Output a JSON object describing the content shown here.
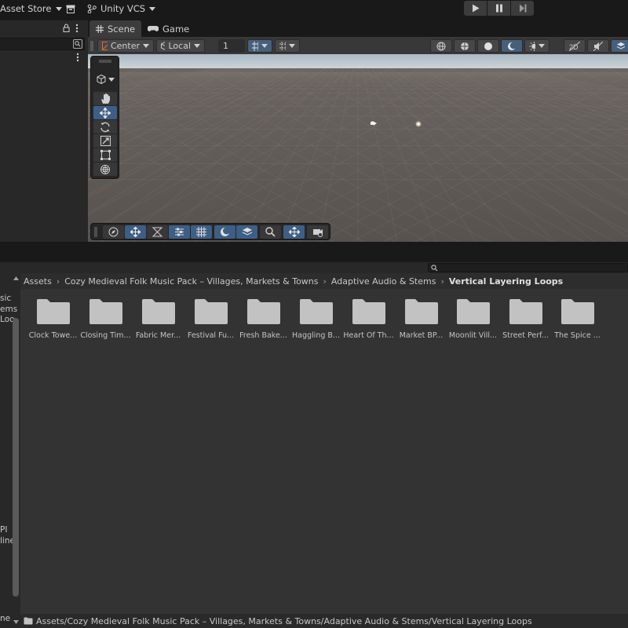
{
  "topbar": {
    "asset_store": "Asset Store",
    "version_control": "Unity VCS"
  },
  "scene_tabs": [
    {
      "label": "Scene",
      "icon": "grid-icon"
    },
    {
      "label": "Game",
      "icon": "gamepad-icon"
    }
  ],
  "scene_toolbar": {
    "pivot_label": "Center",
    "space_label": "Local",
    "snap_value": "1"
  },
  "project": {
    "breadcrumb": [
      "Assets",
      "Cozy Medieval Folk Music Pack – Villages, Markets & Towns",
      "Adaptive Audio & Stems",
      "Vertical Layering Loops"
    ],
    "folders": [
      "Clock Towe...",
      "Closing Tim...",
      "Fabric Mer...",
      "Festival Fu...",
      "Fresh Bake...",
      "Haggling B...",
      "Heart Of Th...",
      "Market BP...",
      "Moonlit Vill...",
      "Street Perf...",
      "The Spice ..."
    ],
    "status_path": "Assets/Cozy Medieval Folk Music Pack – Villages, Markets & Towns/Adaptive Audio & Stems/Vertical Layering Loops",
    "left_fragments": [
      "sic",
      "ems",
      "Loo",
      "PI",
      "line",
      "ne"
    ]
  },
  "colors": {
    "accent_blue": "#3d5f86",
    "folder": "#c2c2c2",
    "panel": "#333333",
    "sky": "#bcc8d0",
    "ground": "#5c5653"
  }
}
